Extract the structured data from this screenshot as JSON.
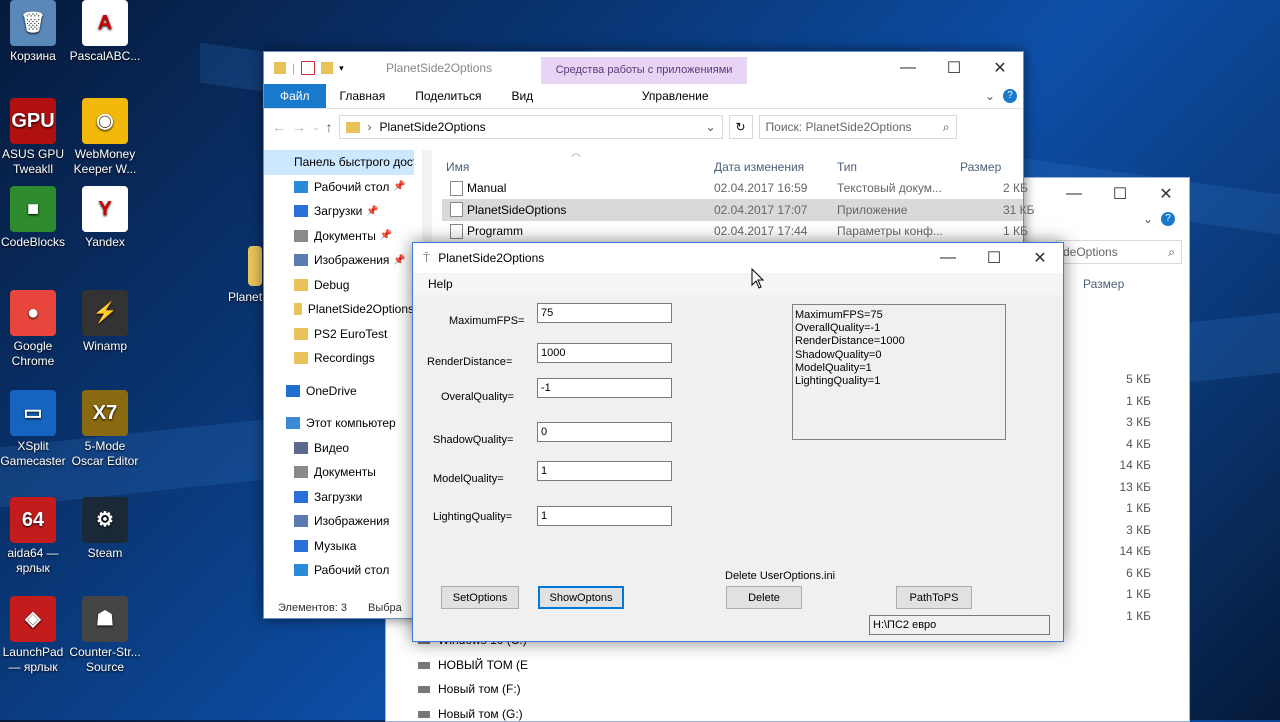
{
  "desktop": {
    "icons": [
      {
        "label": "Корзина",
        "color": "#5a88b8",
        "glyph": "🗑"
      },
      {
        "label": "PascalABC...",
        "color": "#ffffff",
        "glyph": "A"
      },
      {
        "label": "ASUS GPU Tweakll",
        "color": "#b01010",
        "glyph": "GPU"
      },
      {
        "label": "WebMoney Keeper W...",
        "color": "#f2b90a",
        "glyph": "◉"
      },
      {
        "label": "CodeBlocks",
        "color": "#2e8b2e",
        "glyph": "■"
      },
      {
        "label": "Yandex",
        "color": "#ffffff",
        "glyph": "Y"
      },
      {
        "label": "Google Chrome",
        "color": "#e8453c",
        "glyph": "●"
      },
      {
        "label": "Winamp",
        "color": "#333333",
        "glyph": "⚡"
      },
      {
        "label": "XSplit Gamecaster",
        "color": "#1565c0",
        "glyph": "▭"
      },
      {
        "label": "5-Mode Oscar Editor",
        "color": "#8a6a10",
        "glyph": "X7"
      },
      {
        "label": "aida64 — ярлык",
        "color": "#c41c1c",
        "glyph": "64"
      },
      {
        "label": "Steam",
        "color": "#1b2838",
        "glyph": "⚙"
      },
      {
        "label": "LaunchPad — ярлык",
        "color": "#c41c1c",
        "glyph": "◈"
      },
      {
        "label": "Counter-Str... Source",
        "color": "#444444",
        "glyph": "☗"
      }
    ],
    "partial_label": "Planet"
  },
  "explorer": {
    "title": "PlanetSide2Options",
    "tools_tab": "Средства работы с приложениями",
    "tabs": [
      "Файл",
      "Главная",
      "Поделиться",
      "Вид"
    ],
    "manage_tab": "Управление",
    "address": "PlanetSide2Options",
    "search_placeholder": "Поиск: PlanetSide2Options",
    "columns": {
      "name": "Имя",
      "date": "Дата изменения",
      "type": "Тип",
      "size": "Размер"
    },
    "files": [
      {
        "name": "Manual",
        "date": "02.04.2017 16:59",
        "type": "Текстовый докум...",
        "size": "2 КБ"
      },
      {
        "name": "PlanetSideOptions",
        "date": "02.04.2017 17:07",
        "type": "Приложение",
        "size": "31 КБ"
      },
      {
        "name": "Programm",
        "date": "02.04.2017 17:44",
        "type": "Параметры конф...",
        "size": "1 КБ"
      }
    ],
    "nav": [
      {
        "label": "Панель быстрого доступа",
        "icon": "star-icon",
        "color": "#1e7fd8"
      },
      {
        "label": "Рабочий стол",
        "icon": "desktop-icon",
        "color": "#2a8ad8",
        "pin": true
      },
      {
        "label": "Загрузки",
        "icon": "download-icon",
        "color": "#2a6ed8",
        "pin": true
      },
      {
        "label": "Документы",
        "icon": "documents-icon",
        "color": "#8a8a8a",
        "pin": true
      },
      {
        "label": "Изображения",
        "icon": "pictures-icon",
        "color": "#5a7ab0",
        "pin": true
      },
      {
        "label": "Debug",
        "icon": "folder-icon",
        "color": "#e8c35a"
      },
      {
        "label": "PlanetSide2Options",
        "icon": "folder-icon",
        "color": "#e8c35a"
      },
      {
        "label": "PS2 EuroTest",
        "icon": "folder-icon",
        "color": "#e8c35a"
      },
      {
        "label": "Recordings",
        "icon": "folder-icon",
        "color": "#e8c35a"
      },
      {
        "label": "OneDrive",
        "icon": "cloud-icon",
        "color": "#1e6fd0"
      },
      {
        "label": "Этот компьютер",
        "icon": "computer-icon",
        "color": "#3a8ad8"
      },
      {
        "label": "Видео",
        "icon": "video-icon",
        "color": "#5a6a8a"
      },
      {
        "label": "Документы",
        "icon": "documents-icon",
        "color": "#8a8a8a"
      },
      {
        "label": "Загрузки",
        "icon": "download-icon",
        "color": "#2a6ed8"
      },
      {
        "label": "Изображения",
        "icon": "pictures-icon",
        "color": "#5a7ab0"
      },
      {
        "label": "Музыка",
        "icon": "music-icon",
        "color": "#2a6ed8"
      },
      {
        "label": "Рабочий стол",
        "icon": "desktop-icon",
        "color": "#2a8ad8"
      }
    ],
    "status_count": "Элементов: 3",
    "status_selected": "Выбра"
  },
  "back_explorer": {
    "search_fragment": "deOptions",
    "size_header": "Размер",
    "sizes": [
      "5 КБ",
      "1 КБ",
      "3 КБ",
      "4 КБ",
      "14 КБ",
      "13 КБ",
      "1 КБ",
      "3 КБ",
      "14 КБ",
      "6 КБ",
      "1 КБ",
      "1 КБ"
    ],
    "drives": [
      "Windows 10 (C:)",
      "НОВЫЙ ТОМ (E",
      "Новый том (F:)",
      "Новый том (G:)"
    ]
  },
  "app": {
    "title": "PlanetSide2Options",
    "menu_help": "Help",
    "fields": [
      {
        "label": "MaximumFPS=",
        "value": "75"
      },
      {
        "label": "RenderDistance=",
        "value": "1000"
      },
      {
        "label": "OveralQuality=",
        "value": "-1"
      },
      {
        "label": "ShadowQuality=",
        "value": "0"
      },
      {
        "label": "ModelQuality=",
        "value": "1"
      },
      {
        "label": "LightingQuality=",
        "value": "1"
      }
    ],
    "memo_lines": [
      "MaximumFPS=75",
      "OverallQuality=-1",
      "RenderDistance=1000",
      "ShadowQuality=0",
      "ModelQuality=1",
      "LightingQuality=1"
    ],
    "delete_caption": "Delete UserOptions.ini",
    "buttons": {
      "set": "SetOptions",
      "show": "ShowOptons",
      "delete": "Delete",
      "path": "PathToPS"
    },
    "path_value": "H:\\ПС2 евро"
  }
}
